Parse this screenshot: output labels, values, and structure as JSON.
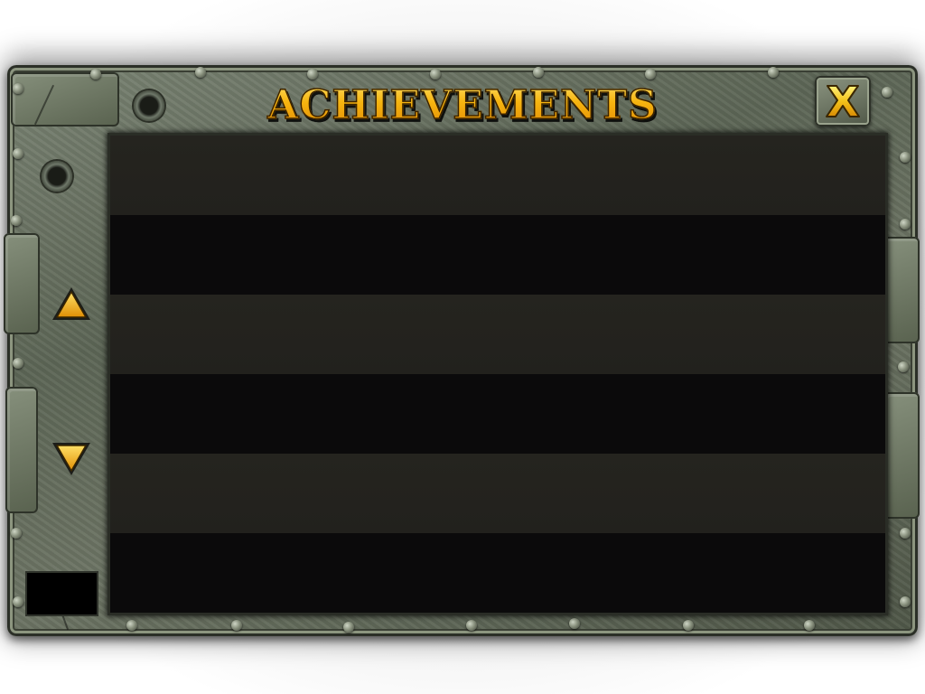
{
  "window": {
    "title": "ACHIEVEMENTS"
  },
  "controls": {
    "close_icon": "close-x-icon",
    "scroll_up_icon": "triangle-up-icon",
    "scroll_down_icon": "triangle-down-icon"
  },
  "achievements_list": {
    "rows": [
      {
        "shade": "light"
      },
      {
        "shade": "dark"
      },
      {
        "shade": "light"
      },
      {
        "shade": "dark"
      },
      {
        "shade": "light"
      },
      {
        "shade": "dark"
      }
    ]
  },
  "colors": {
    "title_gold": "#f3b20d",
    "title_outline": "#3a2200",
    "list_row_light": "#23221e",
    "list_row_dark": "#0b0a0b",
    "frame_stone": "#5d6656",
    "arrow_fill": "#f3b20d"
  }
}
